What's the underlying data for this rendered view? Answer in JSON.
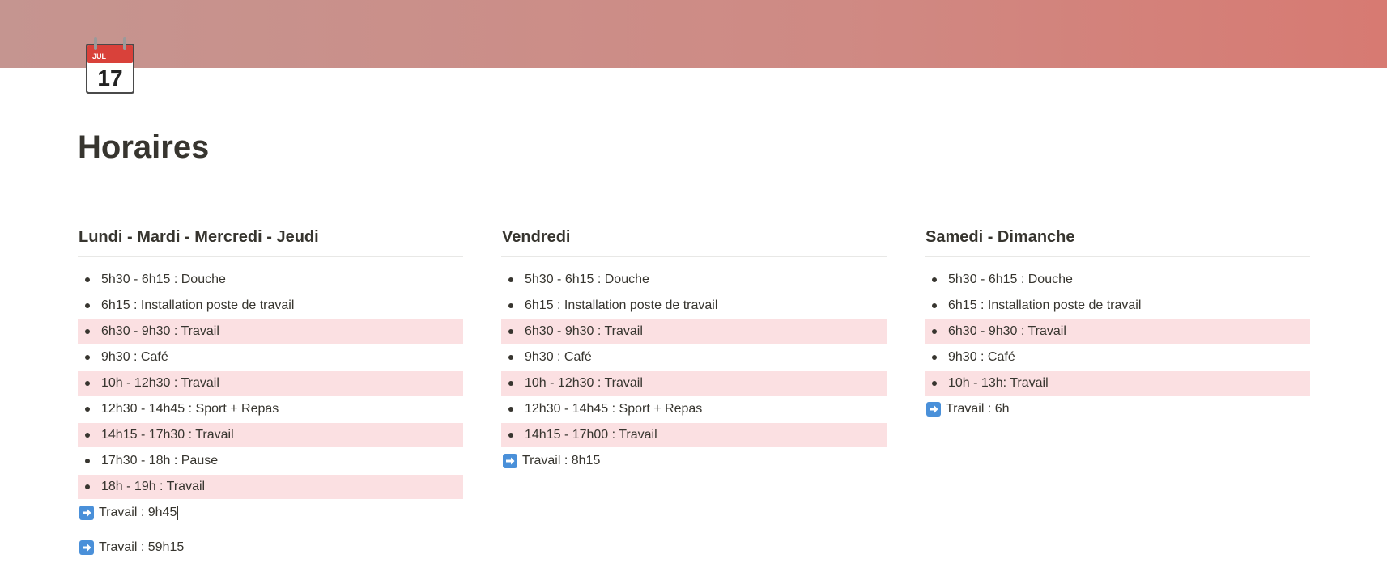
{
  "page": {
    "title": "Horaires",
    "icon": "calendar-icon",
    "icon_month": "JUL",
    "icon_day": "17",
    "cover_color": "#d07f78"
  },
  "columns": [
    {
      "heading": "Lundi - Mardi - Mercredi - Jeudi",
      "items": [
        {
          "text": "5h30 - 6h15 : Douche",
          "highlight": false
        },
        {
          "text": "6h15 : Installation poste de travail",
          "highlight": false
        },
        {
          "text": "6h30 - 9h30 : Travail",
          "highlight": true
        },
        {
          "text": "9h30 : Café",
          "highlight": false
        },
        {
          "text": "10h - 12h30 : Travail",
          "highlight": true
        },
        {
          "text": "12h30 - 14h45 : Sport + Repas",
          "highlight": false
        },
        {
          "text": "14h15 - 17h30 : Travail",
          "highlight": true
        },
        {
          "text": "17h30 - 18h : Pause",
          "highlight": false
        },
        {
          "text": "18h - 19h : Travail",
          "highlight": true
        }
      ],
      "total": "Travail : 9h45"
    },
    {
      "heading": "Vendredi",
      "items": [
        {
          "text": "5h30 - 6h15 : Douche",
          "highlight": false
        },
        {
          "text": "6h15 : Installation poste de travail",
          "highlight": false
        },
        {
          "text": "6h30 - 9h30 : Travail",
          "highlight": true
        },
        {
          "text": "9h30 : Café",
          "highlight": false
        },
        {
          "text": "10h - 12h30 : Travail",
          "highlight": true
        },
        {
          "text": "12h30 - 14h45 : Sport + Repas",
          "highlight": false
        },
        {
          "text": "14h15 - 17h00 : Travail",
          "highlight": true
        }
      ],
      "total": "Travail : 8h15"
    },
    {
      "heading": "Samedi - Dimanche",
      "items": [
        {
          "text": "5h30 - 6h15 : Douche",
          "highlight": false
        },
        {
          "text": "6h15 : Installation poste de travail",
          "highlight": false
        },
        {
          "text": "6h30 - 9h30 : Travail",
          "highlight": true
        },
        {
          "text": "9h30 : Café",
          "highlight": false
        },
        {
          "text": "10h - 13h: Travail",
          "highlight": true
        }
      ],
      "total": "Travail : 6h"
    }
  ],
  "grand_total": "Travail : 59h15",
  "colors": {
    "highlight": "#fbe0e2",
    "text": "#37352f",
    "arrow_blue": "#4a90d9"
  }
}
